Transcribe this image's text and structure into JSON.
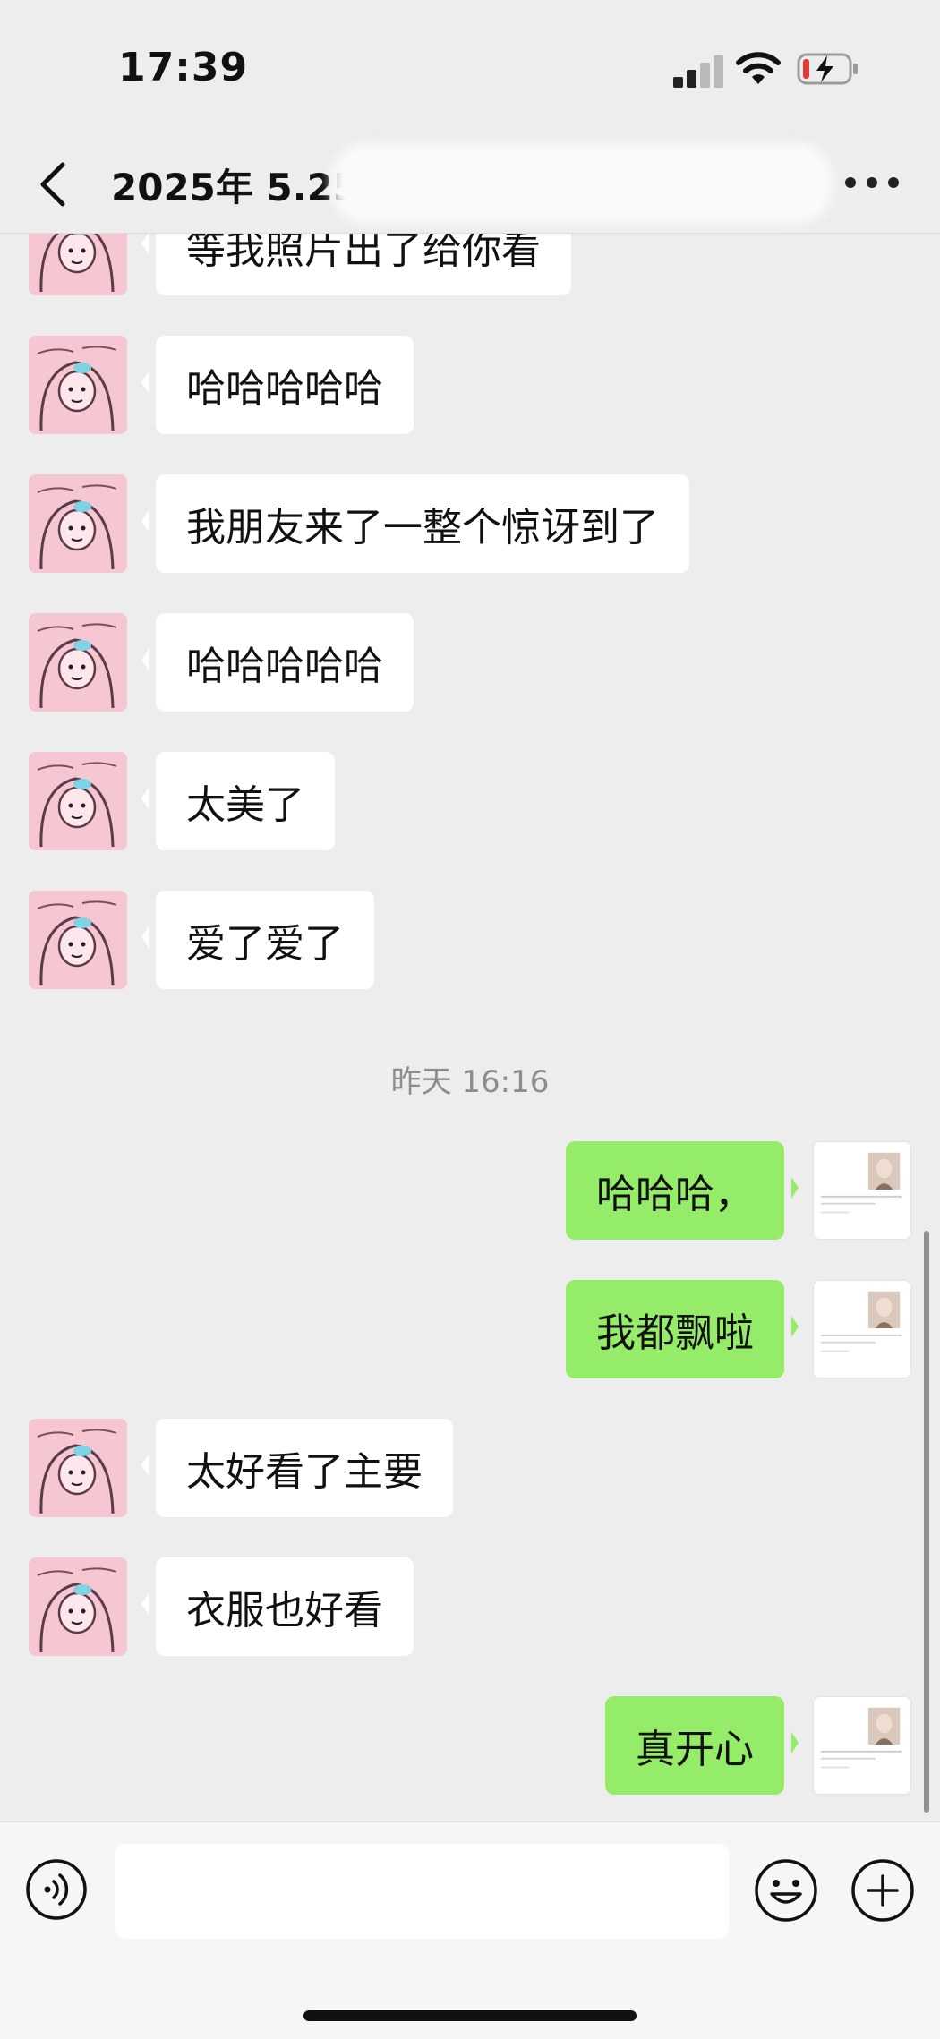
{
  "status": {
    "time": "17:39"
  },
  "nav": {
    "title": "2025年 5.25"
  },
  "messages": [
    {
      "side": "in",
      "text": "等我照片出了给你看"
    },
    {
      "side": "in",
      "text": "哈哈哈哈哈"
    },
    {
      "side": "in",
      "text": "我朋友来了一整个惊讶到了"
    },
    {
      "side": "in",
      "text": "哈哈哈哈哈"
    },
    {
      "side": "in",
      "text": "太美了"
    },
    {
      "side": "in",
      "text": "爱了爱了"
    },
    {
      "side": "time",
      "text": "昨天 16:16"
    },
    {
      "side": "out",
      "text": "哈哈哈，"
    },
    {
      "side": "out",
      "text": "我都飘啦"
    },
    {
      "side": "in",
      "text": "太好看了主要"
    },
    {
      "side": "in",
      "text": "衣服也好看"
    },
    {
      "side": "out",
      "text": "真开心"
    }
  ],
  "icons": {
    "back": "chevron-left-icon",
    "more": "more-dots-icon",
    "voice": "voice-icon",
    "emoji": "emoji-icon",
    "plus": "plus-icon"
  },
  "colors": {
    "outgoing_bubble": "#95ec69",
    "incoming_bubble": "#ffffff",
    "background": "#ededed"
  }
}
